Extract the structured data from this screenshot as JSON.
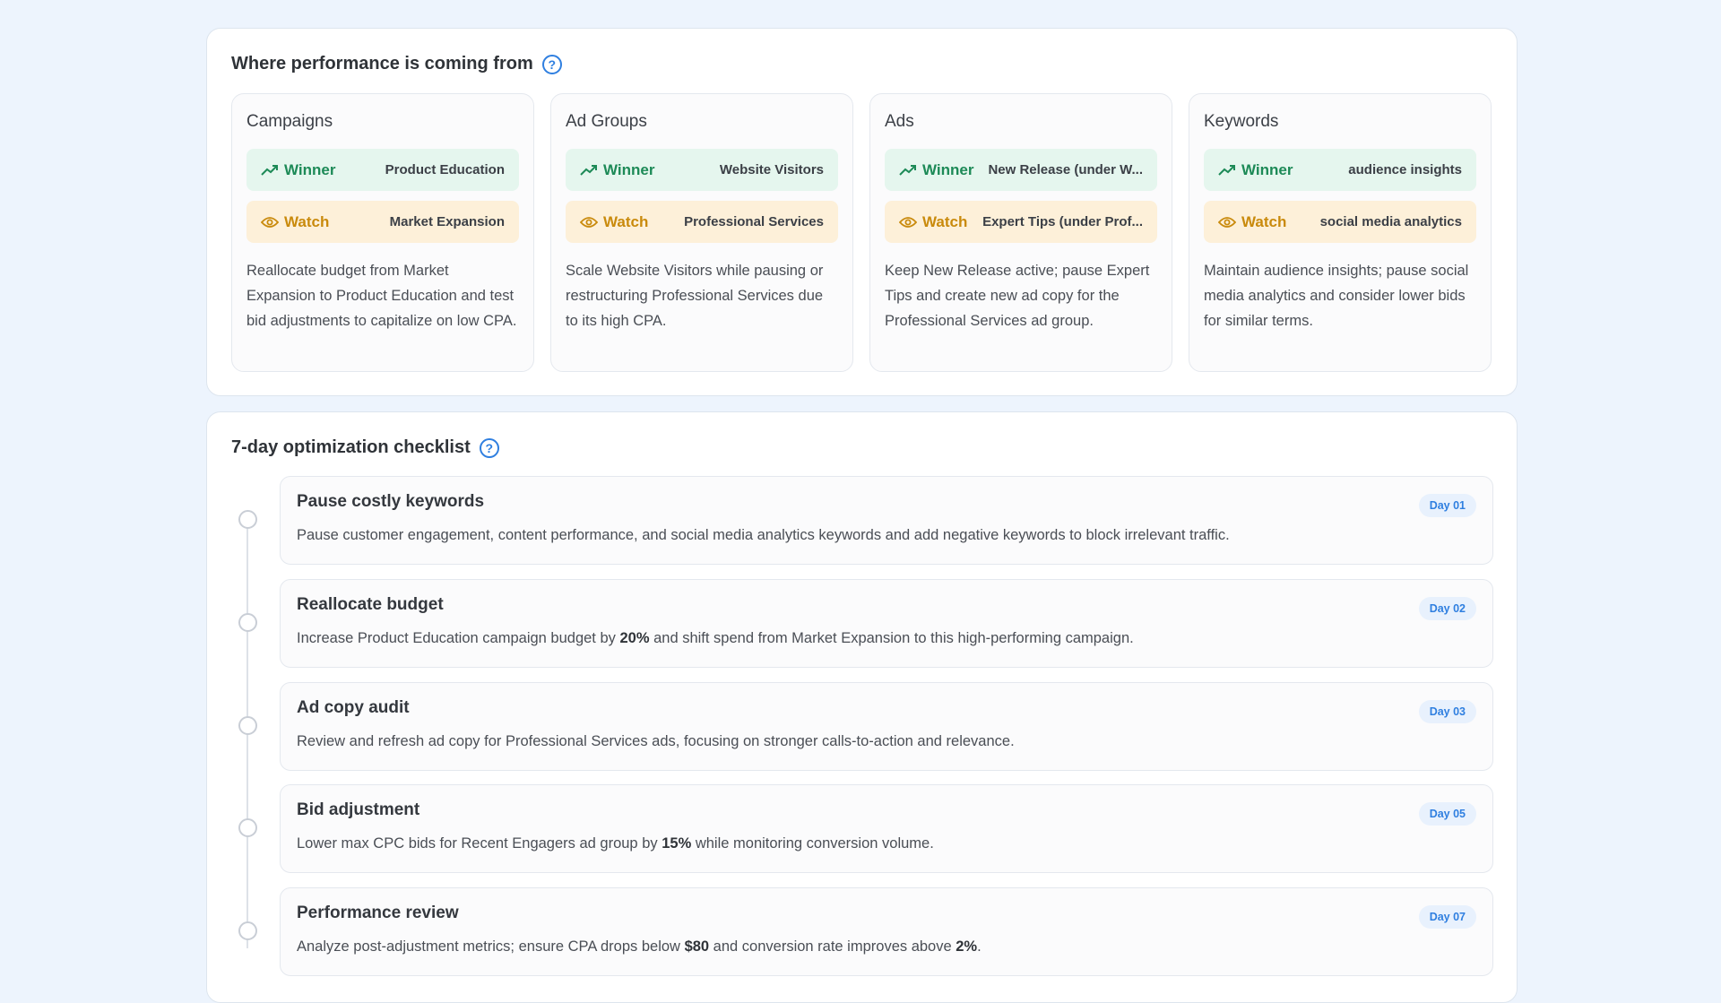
{
  "performance": {
    "title": "Where performance is coming from",
    "cards": [
      {
        "title": "Campaigns",
        "winner_label": "Winner",
        "winner_value": "Product Education",
        "watch_label": "Watch",
        "watch_value": "Market Expansion",
        "description": "Reallocate budget from Market Expansion to Product Education and test bid adjustments to capitalize on low CPA."
      },
      {
        "title": "Ad Groups",
        "winner_label": "Winner",
        "winner_value": "Website Visitors",
        "watch_label": "Watch",
        "watch_value": "Professional Services",
        "description": "Scale Website Visitors while pausing or restructuring Professional Services due to its high CPA."
      },
      {
        "title": "Ads",
        "winner_label": "Winner",
        "winner_value": "New Release (under W...",
        "watch_label": "Watch",
        "watch_value": "Expert Tips (under Prof...",
        "description": "Keep New Release active; pause Expert Tips and create new ad copy for the Professional Services ad group."
      },
      {
        "title": "Keywords",
        "winner_label": "Winner",
        "winner_value": "audience insights",
        "watch_label": "Watch",
        "watch_value": "social media analytics",
        "description": "Maintain audience insights; pause social media analytics and consider lower bids for similar terms."
      }
    ]
  },
  "checklist": {
    "title": "7-day optimization checklist",
    "steps": [
      {
        "title": "Pause costly keywords",
        "day": "Day 01",
        "body_pre": "Pause customer engagement, content performance, and social media analytics keywords and add negative keywords to block irrelevant traffic.",
        "body_b1": "",
        "body_mid": "",
        "body_b2": "",
        "body_post": ""
      },
      {
        "title": "Reallocate budget",
        "day": "Day 02",
        "body_pre": "Increase Product Education campaign budget by ",
        "body_b1": "20%",
        "body_mid": " and shift spend from Market Expansion to this high-performing campaign.",
        "body_b2": "",
        "body_post": ""
      },
      {
        "title": "Ad copy audit",
        "day": "Day 03",
        "body_pre": "Review and refresh ad copy for Professional Services ads, focusing on stronger calls-to-action and relevance.",
        "body_b1": "",
        "body_mid": "",
        "body_b2": "",
        "body_post": ""
      },
      {
        "title": "Bid adjustment",
        "day": "Day 05",
        "body_pre": "Lower max CPC bids for Recent Engagers ad group by ",
        "body_b1": "15%",
        "body_mid": " while monitoring conversion volume.",
        "body_b2": "",
        "body_post": ""
      },
      {
        "title": "Performance review",
        "day": "Day 07",
        "body_pre": "Analyze post-adjustment metrics; ensure CPA drops below ",
        "body_b1": "$80",
        "body_mid": " and conversion rate improves above ",
        "body_b2": "2%",
        "body_post": "."
      }
    ]
  },
  "icons": {
    "help": "question-circle-icon",
    "winner": "trending-up-icon",
    "watch": "eye-icon",
    "step": "circle-icon"
  },
  "colors": {
    "accent": "#2f7fe0",
    "winner": "#1d8a57",
    "winner_bg": "#e5f6ee",
    "watch": "#c98a0c",
    "watch_bg": "#fdf0d9",
    "page_bg": "#edf4fd"
  }
}
